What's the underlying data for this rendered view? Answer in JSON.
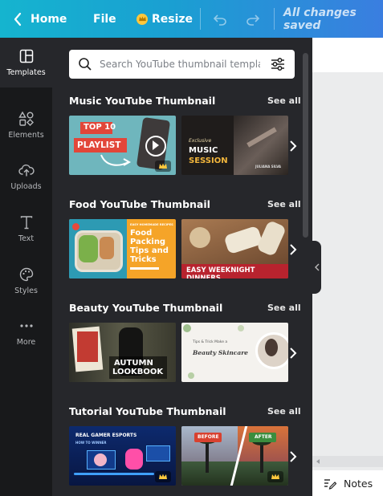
{
  "toolbar": {
    "home_label": "Home",
    "file_label": "File",
    "resize_label": "Resize",
    "status": "All changes saved"
  },
  "sidebar": {
    "items": [
      {
        "label": "Templates",
        "icon": "templates-icon",
        "active": true
      },
      {
        "label": "Elements",
        "icon": "elements-icon"
      },
      {
        "label": "Uploads",
        "icon": "uploads-icon"
      },
      {
        "label": "Text",
        "icon": "text-icon"
      },
      {
        "label": "Styles",
        "icon": "styles-icon"
      },
      {
        "label": "More",
        "icon": "more-icon"
      }
    ]
  },
  "search": {
    "placeholder": "Search YouTube thumbnail templates"
  },
  "sections": [
    {
      "title": "Music YouTube Thumbnail",
      "see_all": "See all",
      "thumbs": [
        {
          "lines": [
            "TOP 10",
            "PLAYLIST"
          ],
          "pro": true
        },
        {
          "lines": [
            "Exclusive",
            "MUSIC",
            "SESSION",
            "JULIANA SILVA"
          ],
          "pro": false
        }
      ]
    },
    {
      "title": "Food YouTube Thumbnail",
      "see_all": "See all",
      "thumbs": [
        {
          "lines": [
            "EASY HOMEMADE RECIPES",
            "Food",
            "Packing",
            "Tips and",
            "Tricks"
          ],
          "pro": false
        },
        {
          "lines": [
            "EASY WEEKNIGHT DINNERS"
          ],
          "pro": false
        }
      ]
    },
    {
      "title": "Beauty YouTube Thumbnail",
      "see_all": "See all",
      "thumbs": [
        {
          "lines": [
            "AUTUMN",
            "LOOKBOOK"
          ],
          "pro": false
        },
        {
          "lines": [
            "Tips & Trick Make a",
            "Beauty Skincare"
          ],
          "pro": false
        }
      ]
    },
    {
      "title": "Tutorial YouTube Thumbnail",
      "see_all": "See all",
      "thumbs": [
        {
          "lines": [
            "REAL GAMER ESPORTS",
            "HOW TO WINNER"
          ],
          "pro": true
        },
        {
          "lines": [
            "BEFORE",
            "AFTER"
          ],
          "pro": true
        }
      ]
    }
  ],
  "notes_label": "Notes",
  "colors": {
    "accent": "#1a9fd2",
    "panel": "#26272b",
    "rail": "#18191b",
    "pro": "#ffc83d"
  }
}
